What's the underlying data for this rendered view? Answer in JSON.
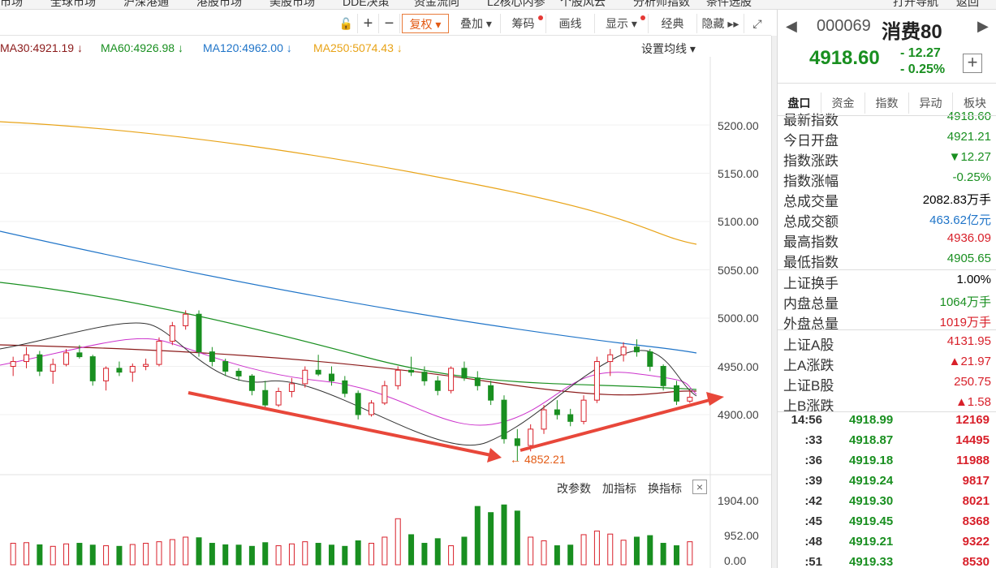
{
  "nav": [
    "市场",
    "全球市场",
    "沪深港通",
    "港股市场",
    "美股市场",
    "DDE决策",
    "资金流向",
    "L2核心内参",
    "个股风云",
    "分析师指数",
    "条件选股",
    "打开导航",
    "返回"
  ],
  "toolbar": {
    "fuquan": "复权",
    "diejia": "叠加",
    "chouma": "筹码",
    "huaxian": "画线",
    "xianshi": "显示",
    "jingdian": "经典",
    "yincang": "隐藏"
  },
  "ma": {
    "ma30": "MA30:4921.19",
    "ma60": "MA60:4926.98",
    "ma120": "MA120:4962.00",
    "ma250": "MA250:5074.43",
    "set": "设置均线"
  },
  "low_label": "4852.21",
  "chart_data": {
    "type": "candlestick",
    "y_ticks": [
      "5200.00",
      "5150.00",
      "5100.00",
      "5050.00",
      "5000.00",
      "4950.00",
      "4900.00"
    ],
    "vol_ticks": [
      "1904.00",
      "952.00",
      "0.00"
    ],
    "low_mark": 4852.21,
    "candles": [
      [
        4950,
        4960,
        4940,
        4955
      ],
      [
        4955,
        4970,
        4948,
        4962
      ],
      [
        4962,
        4966,
        4940,
        4945
      ],
      [
        4945,
        4958,
        4932,
        4952
      ],
      [
        4952,
        4968,
        4950,
        4964
      ],
      [
        4964,
        4972,
        4958,
        4960
      ],
      [
        4960,
        4962,
        4930,
        4935
      ],
      [
        4935,
        4950,
        4925,
        4948
      ],
      [
        4948,
        4955,
        4940,
        4944
      ],
      [
        4944,
        4953,
        4934,
        4950
      ],
      [
        4950,
        4958,
        4946,
        4952
      ],
      [
        4952,
        4980,
        4950,
        4976
      ],
      [
        4976,
        4996,
        4972,
        4992
      ],
      [
        4992,
        5008,
        4988,
        5004
      ],
      [
        5004,
        5008,
        4960,
        4965
      ],
      [
        4965,
        4970,
        4950,
        4955
      ],
      [
        4955,
        4958,
        4940,
        4945
      ],
      [
        4945,
        4948,
        4935,
        4940
      ],
      [
        4940,
        4942,
        4920,
        4925
      ],
      [
        4925,
        4935,
        4905,
        4910
      ],
      [
        4910,
        4928,
        4908,
        4924
      ],
      [
        4924,
        4938,
        4918,
        4932
      ],
      [
        4932,
        4950,
        4928,
        4946
      ],
      [
        4946,
        4962,
        4940,
        4942
      ],
      [
        4942,
        4950,
        4930,
        4935
      ],
      [
        4935,
        4940,
        4918,
        4922
      ],
      [
        4922,
        4925,
        4895,
        4900
      ],
      [
        4900,
        4915,
        4898,
        4912
      ],
      [
        4912,
        4935,
        4910,
        4930
      ],
      [
        4930,
        4950,
        4926,
        4946
      ],
      [
        4946,
        4960,
        4940,
        4944
      ],
      [
        4944,
        4950,
        4930,
        4935
      ],
      [
        4935,
        4940,
        4920,
        4925
      ],
      [
        4925,
        4950,
        4922,
        4948
      ],
      [
        4948,
        4955,
        4935,
        4938
      ],
      [
        4938,
        4945,
        4925,
        4930
      ],
      [
        4930,
        4935,
        4910,
        4915
      ],
      [
        4915,
        4920,
        4870,
        4875
      ],
      [
        4875,
        4885,
        4852,
        4868
      ],
      [
        4868,
        4890,
        4862,
        4885
      ],
      [
        4885,
        4910,
        4880,
        4905
      ],
      [
        4905,
        4915,
        4895,
        4900
      ],
      [
        4900,
        4906,
        4888,
        4893
      ],
      [
        4893,
        4920,
        4890,
        4915
      ],
      [
        4915,
        4960,
        4912,
        4955
      ],
      [
        4955,
        4968,
        4940,
        4962
      ],
      [
        4962,
        4975,
        4955,
        4970
      ],
      [
        4970,
        4978,
        4960,
        4965
      ],
      [
        4965,
        4968,
        4945,
        4950
      ],
      [
        4950,
        4952,
        4925,
        4930
      ],
      [
        4930,
        4935,
        4910,
        4914
      ],
      [
        4914,
        4925,
        4912,
        4918
      ]
    ],
    "volumes": [
      700,
      720,
      650,
      600,
      680,
      700,
      640,
      620,
      600,
      660,
      700,
      750,
      820,
      900,
      880,
      700,
      650,
      640,
      600,
      720,
      620,
      680,
      750,
      700,
      640,
      600,
      780,
      700,
      900,
      1500,
      980,
      700,
      850,
      620,
      900,
      1900,
      1700,
      1950,
      1750,
      900,
      780,
      620,
      640,
      980,
      1100,
      1000,
      800,
      900,
      950,
      700,
      620,
      750
    ]
  },
  "right": {
    "code": "000069",
    "name": "消费80",
    "price": "4918.60",
    "chg": "- 12.27",
    "pct": "- 0.25%",
    "tabs": [
      "盘口",
      "资金",
      "指数",
      "异动",
      "板块"
    ],
    "rows": [
      [
        "最新指数",
        "4918.60"
      ],
      [
        "今日开盘",
        "4921.21"
      ],
      [
        "指数涨跌",
        "▼12.27"
      ],
      [
        "指数涨幅",
        "-0.25%"
      ],
      [
        "总成交量",
        "2082.83万手"
      ],
      [
        "总成交额",
        "463.62亿元"
      ],
      [
        "最高指数",
        "4936.09"
      ],
      [
        "最低指数",
        "4905.65"
      ],
      [
        "上证换手",
        "1.00%"
      ],
      [
        "内盘总量",
        "1064万手"
      ],
      [
        "外盘总量",
        "1019万手"
      ],
      [
        "上证A股",
        "4131.95"
      ],
      [
        "上A涨跌",
        "▲21.97"
      ],
      [
        "上证B股",
        "250.75"
      ],
      [
        "上B涨跌",
        "▲1.58"
      ]
    ],
    "ticks": [
      [
        "14:56",
        "4918.99",
        "12169"
      ],
      [
        ":33",
        "4918.87",
        "14495"
      ],
      [
        ":36",
        "4919.18",
        "11988"
      ],
      [
        ":39",
        "4919.24",
        "9817"
      ],
      [
        ":42",
        "4919.30",
        "8021"
      ],
      [
        ":45",
        "4919.45",
        "8368"
      ],
      [
        ":48",
        "4919.21",
        "9322"
      ],
      [
        ":51",
        "4919.33",
        "8530"
      ]
    ]
  },
  "bottom": {
    "gaicanshu": "改参数",
    "jiazhibiao": "加指标",
    "huanzhibiao": "换指标"
  }
}
